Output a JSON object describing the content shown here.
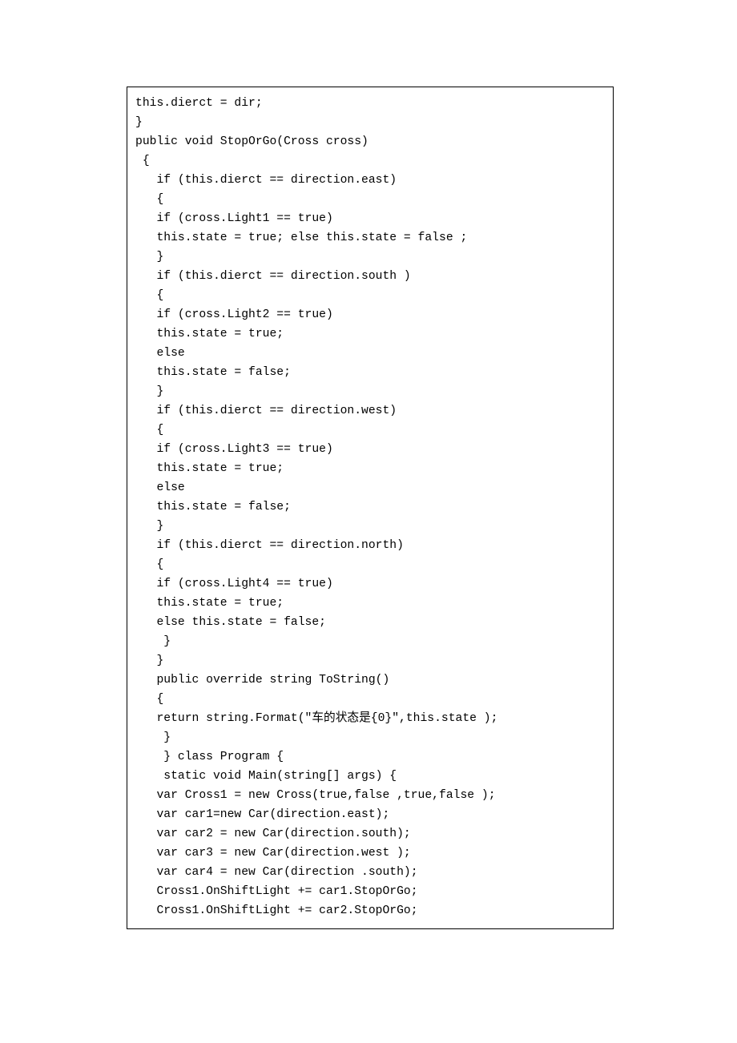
{
  "code": {
    "lines": [
      "this.dierct = dir;",
      "}",
      "public void StopOrGo(Cross cross)",
      " {",
      "   if (this.dierct == direction.east)",
      "   {",
      "   if (cross.Light1 == true)",
      "   this.state = true; else this.state = false ;",
      "   }",
      "   if (this.dierct == direction.south )",
      "   {",
      "   if (cross.Light2 == true)",
      "   this.state = true;",
      "   else",
      "   this.state = false;",
      "   }",
      "   if (this.dierct == direction.west)",
      "   {",
      "   if (cross.Light3 == true)",
      "   this.state = true;",
      "   else",
      "   this.state = false;",
      "   }",
      "   if (this.dierct == direction.north)",
      "   {",
      "   if (cross.Light4 == true)",
      "   this.state = true;",
      "   else this.state = false;",
      "    }",
      "   }",
      "   public override string ToString()",
      "   {",
      "   return string.Format(\"车的状态是{0}\",this.state );",
      "    }",
      "    } class Program {",
      "    static void Main(string[] args) {",
      "   var Cross1 = new Cross(true,false ,true,false );",
      "   var car1=new Car(direction.east);",
      "   var car2 = new Car(direction.south);",
      "   var car3 = new Car(direction.west );",
      "   var car4 = new Car(direction .south);",
      "",
      "   Cross1.OnShiftLight += car1.StopOrGo;",
      "   Cross1.OnShiftLight += car2.StopOrGo;"
    ]
  }
}
